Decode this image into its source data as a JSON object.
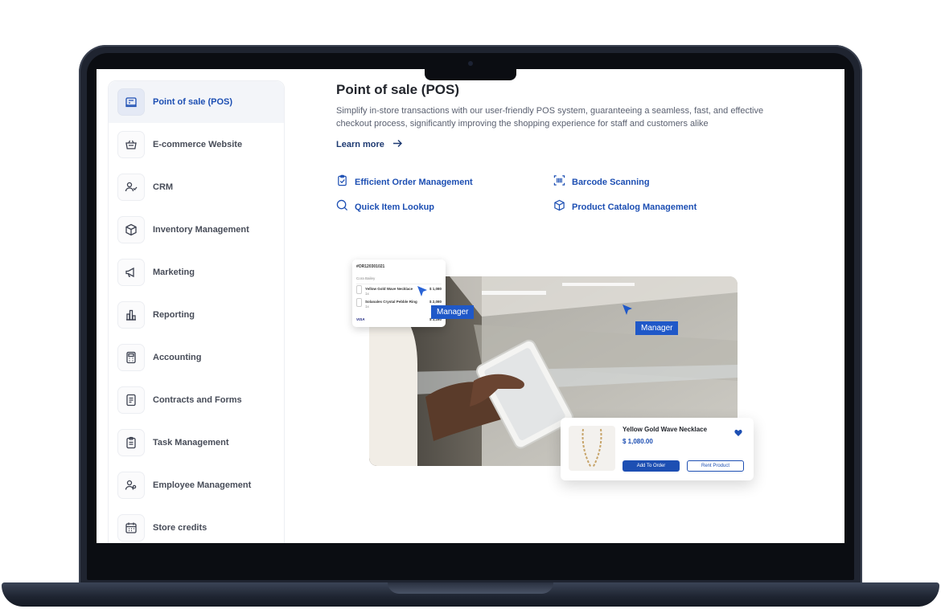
{
  "sidebar": {
    "items": [
      {
        "label": "Point of sale (POS)",
        "icon": "pos-terminal-icon",
        "active": true
      },
      {
        "label": "E-commerce Website",
        "icon": "shopping-basket-icon"
      },
      {
        "label": "CRM",
        "icon": "user-group-icon"
      },
      {
        "label": "Inventory Management",
        "icon": "box-icon"
      },
      {
        "label": "Marketing",
        "icon": "megaphone-icon"
      },
      {
        "label": "Reporting",
        "icon": "bar-chart-icon"
      },
      {
        "label": "Accounting",
        "icon": "calculator-icon"
      },
      {
        "label": "Contracts and Forms",
        "icon": "document-icon"
      },
      {
        "label": "Task Management",
        "icon": "clipboard-icon"
      },
      {
        "label": "Employee Management",
        "icon": "employee-icon"
      },
      {
        "label": "Store credits",
        "icon": "calendar-icon"
      }
    ]
  },
  "main": {
    "title": "Point of sale (POS)",
    "description": "Simplify in-store transactions with our user-friendly POS system, guaranteeing a seamless, fast, and effective checkout process, significantly improving the shopping experience for staff and customers alike",
    "learn_more": "Learn more",
    "features": [
      {
        "label": "Efficient Order Management",
        "icon": "clipboard-check-icon"
      },
      {
        "label": "Barcode Scanning",
        "icon": "barcode-icon"
      },
      {
        "label": "Quick Item Lookup",
        "icon": "search-icon"
      },
      {
        "label": "Product Catalog Management",
        "icon": "cube-icon"
      }
    ]
  },
  "hero": {
    "manager_tag": "Manager",
    "mini_order": {
      "order_id": "#OR120301021",
      "customer": "Cora Bailey",
      "items": [
        {
          "name": "Yellow Gold Wave Necklace",
          "qty": "1x",
          "price": "$ 1,080"
        },
        {
          "name": "Solanales Crystal Pebble Ring",
          "qty": "1x",
          "price": "$ 2,080"
        }
      ],
      "payment": "VISA",
      "total": "$ 3,160"
    },
    "product": {
      "name": "Yellow Gold Wave Necklace",
      "price": "$ 1,080.00",
      "add_button": "Add To Order",
      "rent_button": "Rent Product"
    }
  },
  "colors": {
    "accent": "#1d4fb3",
    "tag": "#1f58c8",
    "laptop_body": "#1f2430"
  }
}
